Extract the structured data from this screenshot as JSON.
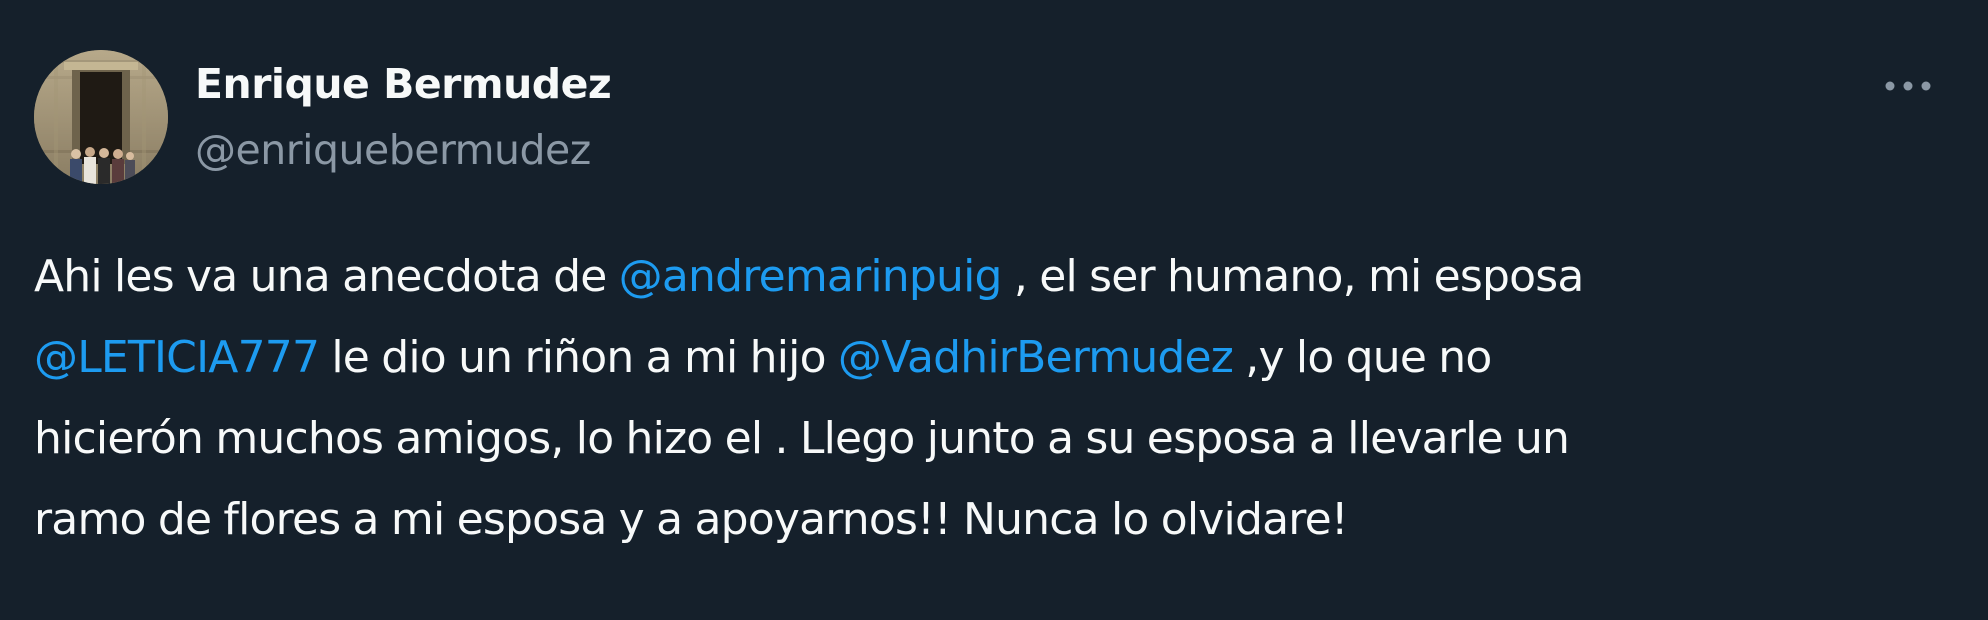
{
  "tweet": {
    "author": {
      "display_name": "Enrique Bermudez",
      "handle": "@enriquebermudez",
      "avatar_icon": "profile-photo"
    },
    "more_icon": "ellipsis-icon",
    "text_lines": [
      [
        {
          "type": "text",
          "value": "Ahi les va una anecdota de "
        },
        {
          "type": "mention",
          "value": "@andremarinpuig"
        },
        {
          "type": "text",
          "value": " , el ser humano, mi esposa"
        }
      ],
      [
        {
          "type": "mention",
          "value": "@LETICIA777"
        },
        {
          "type": "text",
          "value": " le dio un riñon a mi hijo "
        },
        {
          "type": "mention",
          "value": "@VadhirBermudez"
        },
        {
          "type": "text",
          "value": " ,y lo que no"
        }
      ],
      [
        {
          "type": "text",
          "value": "hicierón muchos amigos, lo hizo el . Llego junto a su esposa a llevarle un"
        }
      ],
      [
        {
          "type": "text",
          "value": "ramo de flores a mi esposa y a apoyarnos!! Nunca lo olvidare!"
        }
      ]
    ]
  },
  "colors": {
    "background": "#15202b",
    "text": "#f7f9f9",
    "secondary_text": "#8b98a5",
    "link": "#1d9bf0"
  }
}
